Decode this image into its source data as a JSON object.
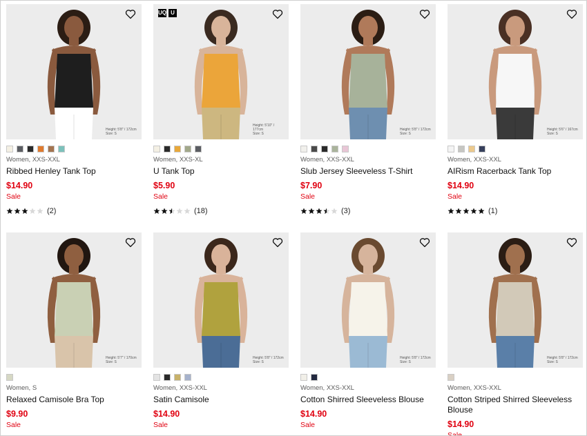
{
  "products": [
    {
      "meta": "Women, XXS-XXL",
      "title": "Ribbed Henley Tank Top",
      "price": "$14.90",
      "sale": "Sale",
      "rating": 3,
      "count": "(2)",
      "swatches": [
        "#f4f0e4",
        "#5b5d62",
        "#2a2a2a",
        "#e07a2e",
        "#a4744f",
        "#7cc1bb"
      ],
      "photo_note": [
        "Height: 5'8\" / 172cm",
        "Size: S"
      ],
      "colors": {
        "top": "#1e1e1e",
        "bottom": "#ffffff",
        "skin": "#8a5a3e",
        "hair": "#2b1d14"
      },
      "logos": []
    },
    {
      "meta": "Women, XXS-XL",
      "title": "U Tank Top",
      "price": "$5.90",
      "sale": "Sale",
      "rating": 2.5,
      "count": "(18)",
      "swatches": [
        "#f4f0e4",
        "#2a2a2a",
        "#e8a83a",
        "#a2a88a",
        "#5b5d62"
      ],
      "photo_note": [
        "Height: 5'10\" / 177cm",
        "Size: S"
      ],
      "colors": {
        "top": "#eba53a",
        "bottom": "#cdb780",
        "skin": "#d8b49a",
        "hair": "#3a2a20"
      },
      "logos": [
        "UQ",
        "U"
      ]
    },
    {
      "meta": "Women, XXS-XXL",
      "title": "Slub Jersey Sleeveless T-Shirt",
      "price": "$7.90",
      "sale": "Sale",
      "rating": 3.5,
      "count": "(3)",
      "swatches": [
        "#f1f0ec",
        "#4a4a4a",
        "#2a2a2a",
        "#aab49c",
        "#e8c6d6"
      ],
      "photo_note": [
        "Height: 5'8\" / 172cm",
        "Size: S"
      ],
      "colors": {
        "top": "#a7b29a",
        "bottom": "#6e8fb0",
        "skin": "#b07a5a",
        "hair": "#2b1d14"
      },
      "logos": []
    },
    {
      "meta": "Women, XXS-XXL",
      "title": "AIRism Racerback Tank Top",
      "price": "$14.90",
      "sale": "Sale",
      "rating": 5,
      "count": "(1)",
      "swatches": [
        "#f4f4f4",
        "#c6c6c2",
        "#ecc98c",
        "#37405c"
      ],
      "photo_note": [
        "Height: 5'6\" / 167cm",
        "Size: S"
      ],
      "colors": {
        "top": "#f7f7f7",
        "bottom": "#3a3a3a",
        "skin": "#c99a7d",
        "hair": "#4a3024"
      },
      "logos": []
    },
    {
      "meta": "Women, S",
      "title": "Relaxed Camisole Bra Top",
      "price": "$9.90",
      "sale": "Sale",
      "rating": 0,
      "count": "",
      "swatches": [
        "#d6d8c4"
      ],
      "photo_note": [
        "Height: 5'7\" / 170cm",
        "Size: S"
      ],
      "colors": {
        "top": "#c9d0b4",
        "bottom": "#d9c4aa",
        "skin": "#8f5f40",
        "hair": "#211610"
      },
      "logos": []
    },
    {
      "meta": "Women, XXS-XXL",
      "title": "Satin Camisole",
      "price": "$14.90",
      "sale": "Sale",
      "rating": 0,
      "count": "",
      "swatches": [
        "#e4e4e4",
        "#2a2a2a",
        "#c8b26a",
        "#a6b2cc"
      ],
      "photo_note": [
        "Height: 5'8\" / 172cm",
        "Size: S"
      ],
      "colors": {
        "top": "#b0a23e",
        "bottom": "#4b6d96",
        "skin": "#d9b39a",
        "hair": "#3b271b"
      },
      "logos": []
    },
    {
      "meta": "Women, XXS-XXL",
      "title": "Cotton Shirred Sleeveless Blouse",
      "price": "$14.90",
      "sale": "Sale",
      "rating": 0,
      "count": "",
      "swatches": [
        "#f1efe8",
        "#232a40"
      ],
      "photo_note": [
        "Height: 5'8\" / 172cm",
        "Size: S"
      ],
      "colors": {
        "top": "#f6f3ea",
        "bottom": "#9bbad4",
        "skin": "#d6b49c",
        "hair": "#6a4a30"
      },
      "logos": []
    },
    {
      "meta": "Women, XXS-XXL",
      "title": "Cotton Striped Shirred Sleeveless Blouse",
      "price": "$14.90",
      "sale": "Sale",
      "rating": 0,
      "count": "",
      "swatches": [
        "#d9d0c4"
      ],
      "photo_note": [
        "Height: 5'8\" / 172cm",
        "Size: S"
      ],
      "colors": {
        "top": "#d2c9b8",
        "bottom": "#5a7fa8",
        "skin": "#a0704e",
        "hair": "#2b1d14"
      },
      "logos": []
    }
  ]
}
